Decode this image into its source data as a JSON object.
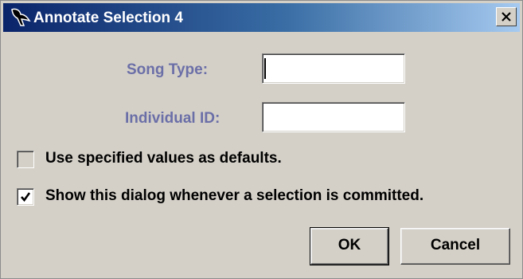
{
  "window": {
    "title": "Annotate Selection 4",
    "icon": "bird-icon",
    "close_icon": "close-icon"
  },
  "fields": {
    "song_type": {
      "label": "Song Type:",
      "value": ""
    },
    "individual_id": {
      "label": "Individual ID:",
      "value": ""
    }
  },
  "options": {
    "use_defaults": {
      "label": "Use specified values as defaults.",
      "checked": false
    },
    "show_dialog": {
      "label": "Show this dialog whenever a selection is committed.",
      "checked": true
    }
  },
  "buttons": {
    "ok": "OK",
    "cancel": "Cancel"
  },
  "colors": {
    "titlebar_start": "#0a246a",
    "titlebar_end": "#a6caf0",
    "label_color": "#6b6fa7",
    "dialog_bg": "#d4d0c8"
  }
}
